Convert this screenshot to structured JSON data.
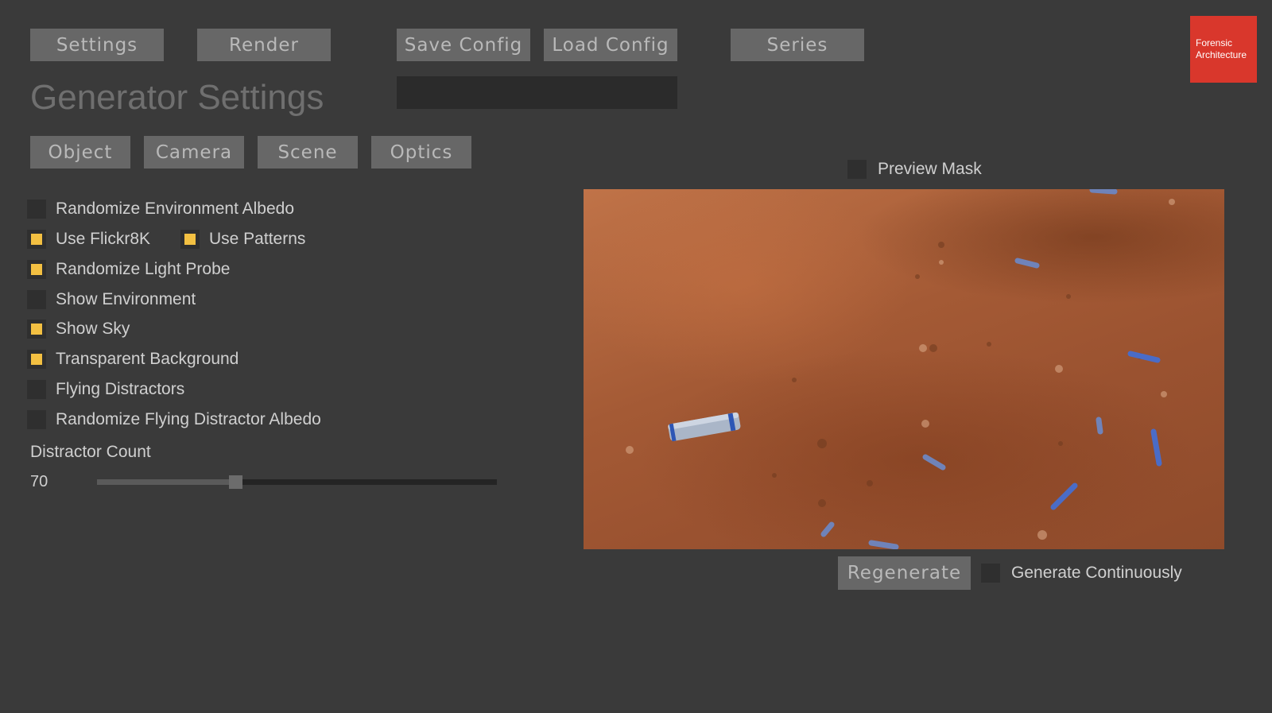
{
  "top_buttons": {
    "settings": "Settings",
    "render": "Render",
    "save_config": "Save Config",
    "load_config": "Load Config",
    "series": "Series"
  },
  "logo": {
    "line1": "Forensic",
    "line2": "Architecture"
  },
  "page_title": "Generator Settings",
  "tabs": {
    "object": "Object",
    "camera": "Camera",
    "scene": "Scene",
    "optics": "Optics"
  },
  "options": {
    "randomize_env_albedo": {
      "label": "Randomize Environment Albedo",
      "checked": false
    },
    "use_flickr8k": {
      "label": "Use Flickr8K",
      "checked": true
    },
    "use_patterns": {
      "label": "Use Patterns",
      "checked": true
    },
    "randomize_light_probe": {
      "label": "Randomize Light Probe",
      "checked": true
    },
    "show_environment": {
      "label": "Show Environment",
      "checked": false
    },
    "show_sky": {
      "label": "Show Sky",
      "checked": true
    },
    "transparent_background": {
      "label": "Transparent Background",
      "checked": true
    },
    "flying_distractors": {
      "label": "Flying Distractors",
      "checked": false
    },
    "randomize_flying_distractor_albedo": {
      "label": "Randomize Flying Distractor Albedo",
      "checked": false
    }
  },
  "distractor_count": {
    "label": "Distractor Count",
    "value": "70",
    "fraction": 0.345
  },
  "preview": {
    "mask_label": "Preview Mask",
    "mask_checked": false,
    "regenerate": "Regenerate",
    "generate_continuously": "Generate Continuously",
    "generate_continuously_checked": false
  },
  "colors": {
    "background": "#3a3a3a",
    "button": "#676767",
    "checkbox_on": "#f3c042",
    "logo": "#d9372c"
  }
}
